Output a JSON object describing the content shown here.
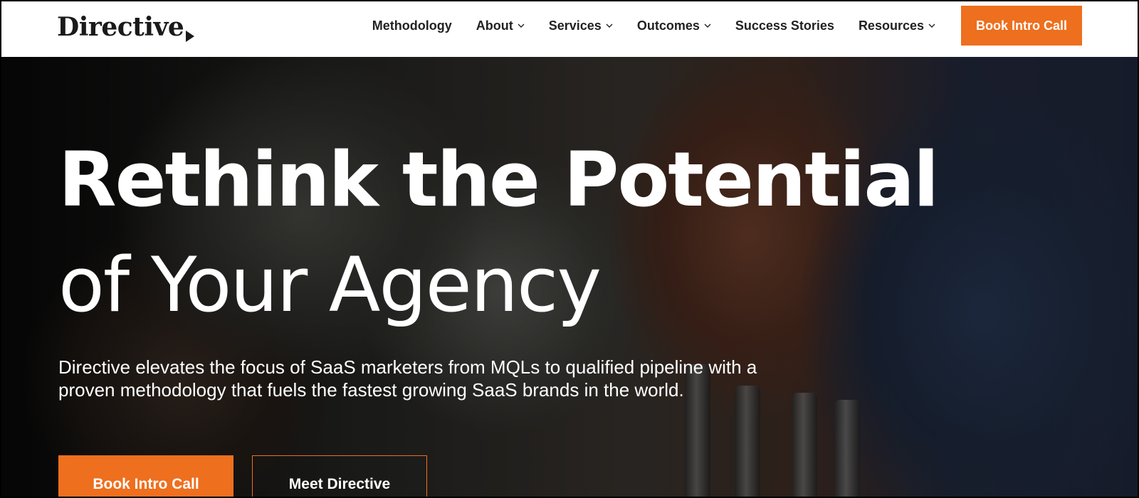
{
  "brand": {
    "name": "Directive",
    "accent": "#ee6f1e"
  },
  "nav": {
    "items": [
      {
        "label": "Methodology",
        "has_dropdown": false
      },
      {
        "label": "About",
        "has_dropdown": true
      },
      {
        "label": "Services",
        "has_dropdown": true
      },
      {
        "label": "Outcomes",
        "has_dropdown": true
      },
      {
        "label": "Success Stories",
        "has_dropdown": false
      },
      {
        "label": "Resources",
        "has_dropdown": true
      }
    ],
    "cta_label": "Book Intro Call"
  },
  "hero": {
    "headline_line1": "Rethink the Potential",
    "headline_line2": "of Your Agency",
    "subtext": "Directive elevates the focus of SaaS marketers from MQLs to qualified pipeline with a proven methodology that fuels the fastest growing SaaS brands in the world.",
    "primary_cta": "Book Intro Call",
    "secondary_cta": "Meet Directive"
  }
}
